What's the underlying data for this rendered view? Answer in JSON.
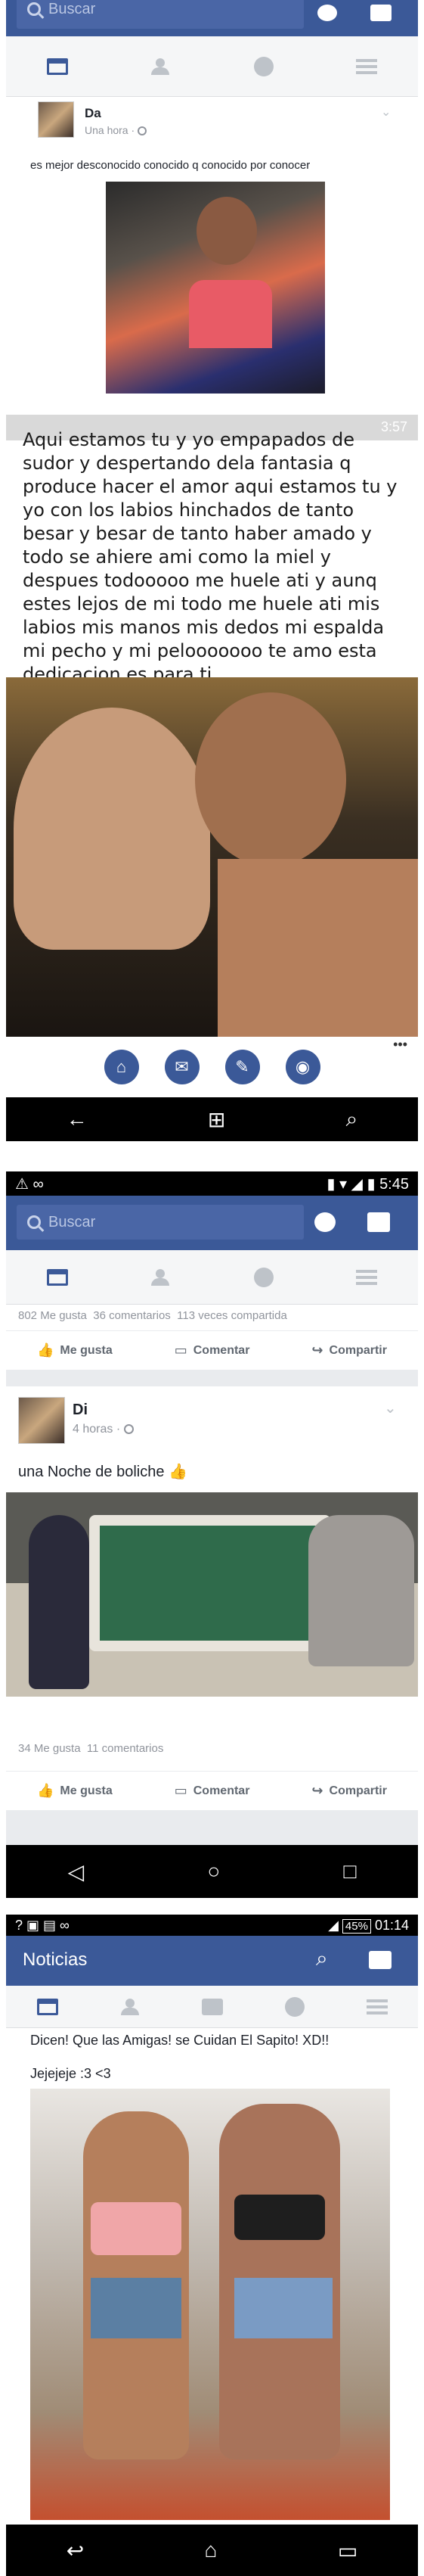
{
  "s1": {
    "search_placeholder": "Buscar",
    "author": "Da",
    "time": "Una hora · ",
    "post_text": "es mejor desconocido conocido q conocido por conocer",
    "embedded_status_time": "3:57",
    "embedded_text": "Aqui estamos tu y yo empapados de sudor y despertando dela fantasia q produce hacer el amor aqui estamos tu y yo con los labios hinchados de tanto besar y besar de tanto haber amado y todo se ahiere ami como la miel y despues todooooo me huele ati y aunq estes lejos de mi todo me huele ati mis labios mis manos mis dedos mi espalda mi pecho y mi pelooooooo te amo esta dedicacion es para ti.",
    "more": "•••"
  },
  "s2": {
    "status_time": "5:45",
    "search_placeholder": "Buscar",
    "stats_likes": "802 Me gusta",
    "stats_comments": "36 comentarios",
    "stats_shares": "113 veces compartida",
    "like": "Me gusta",
    "comment": "Comentar",
    "share": "Compartir",
    "author": "Di",
    "time": "4 horas · ",
    "post_text": "una Noche de boliche 👍",
    "stats2_likes": "34 Me gusta",
    "stats2_comments": "11 comentarios",
    "like2": "Me gusta",
    "comment2": "Comentar",
    "share2": "Compartir"
  },
  "s3": {
    "status_battery": "45%",
    "status_time": "01:14",
    "title": "Noticias",
    "post_line1": "Dicen! Que las Amigas! se Cuidan El Sapito! XD!!",
    "post_line2": "Jejejeje :3 <3"
  },
  "colors": {
    "facebook_blue": "#3b5998",
    "tab_gray": "#bec3c9"
  }
}
